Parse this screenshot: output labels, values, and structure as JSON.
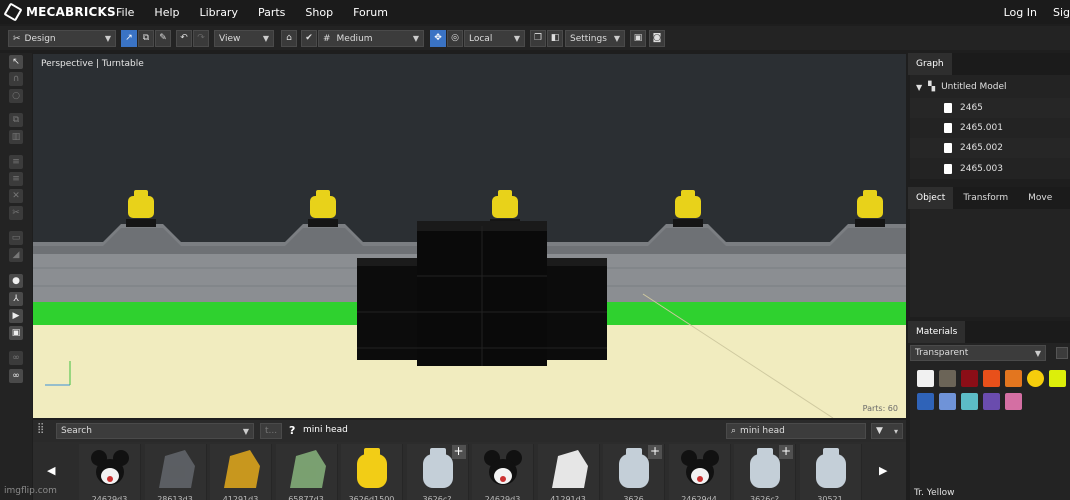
{
  "nav": {
    "brand": "MECABRICKS",
    "items": [
      "File",
      "Help",
      "Library",
      "Parts",
      "Shop",
      "Forum"
    ],
    "login": "Log In",
    "signup": "Sig"
  },
  "toolbar": {
    "mode": "Design",
    "view": "View",
    "quality": "Medium",
    "space": "Local",
    "settings": "Settings"
  },
  "viewport": {
    "label": "Perspective | Turntable",
    "parts_count": "Parts: 60"
  },
  "parts_panel": {
    "search_dropdown": "Search",
    "filter_box": "t...",
    "help_mark": "?",
    "query_label": "mini head",
    "search_value": "mini head",
    "items": [
      {
        "code": "24629d3",
        "kind": "mickey",
        "plus": false
      },
      {
        "code": "28613d3",
        "kind": "wolf",
        "plus": false
      },
      {
        "code": "41291d3",
        "kind": "gold",
        "plus": false
      },
      {
        "code": "65877d3",
        "kind": "green",
        "plus": false
      },
      {
        "code": "3626d1500",
        "kind": "yellow",
        "plus": false
      },
      {
        "code": "3626c?",
        "kind": "grey",
        "plus": true
      },
      {
        "code": "24629d3",
        "kind": "mickey",
        "plus": false
      },
      {
        "code": "41291d3",
        "kind": "white",
        "plus": false
      },
      {
        "code": "3626",
        "kind": "grey",
        "plus": true
      },
      {
        "code": "24629d4",
        "kind": "mickey",
        "plus": false
      },
      {
        "code": "3626c?",
        "kind": "grey",
        "plus": true
      },
      {
        "code": "30521",
        "kind": "grey",
        "plus": false
      }
    ]
  },
  "graph": {
    "tab": "Graph",
    "root": "Untitled Model",
    "items": [
      "2465",
      "2465.001",
      "2465.002",
      "2465.003"
    ]
  },
  "object_tabs": [
    "Object",
    "Transform",
    "Move"
  ],
  "materials": {
    "tab": "Materials",
    "selected": "Transparent",
    "swatches": [
      "#f1f1f1",
      "#6b6457",
      "#8b0e17",
      "#e8501a",
      "#e3761f",
      "#f5cd0c",
      "#dcef0a",
      "#2f63b8",
      "#6f93d8",
      "#5cbcc6",
      "#6a4cae",
      "#d46fa3"
    ],
    "current": "Tr. Yellow"
  },
  "watermark": "imgflip.com"
}
